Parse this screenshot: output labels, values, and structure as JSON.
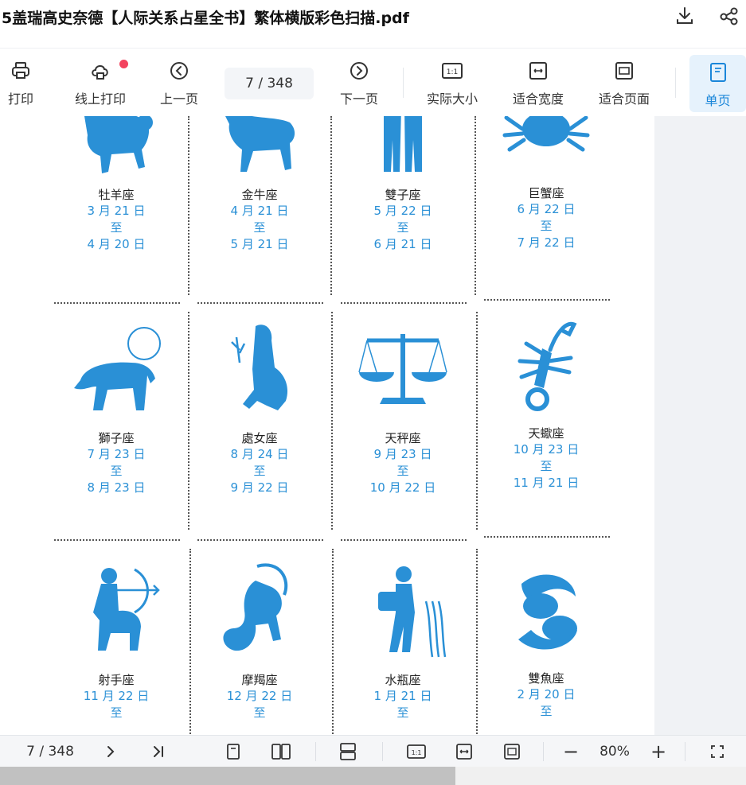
{
  "title": "5盖瑞高史奈德【人际关系占星全书】繁体横版彩色扫描.pdf",
  "top_icons": [
    "download-icon",
    "share-icon"
  ],
  "toolbar": {
    "print": "打印",
    "online_print": "线上打印",
    "prev_page": "上一页",
    "page_display": "7  / 348",
    "next_page": "下一页",
    "actual_size": "实际大小",
    "fit_width": "适合宽度",
    "fit_page": "适合页面",
    "single_page": "单页"
  },
  "signs": [
    {
      "name": "牡羊座",
      "from": "3 月 21 日",
      "to_word": "至",
      "to": "4 月 20 日",
      "icon": "aries-ram-icon"
    },
    {
      "name": "金牛座",
      "from": "4 月 21 日",
      "to_word": "至",
      "to": "5 月 21 日",
      "icon": "taurus-bull-icon"
    },
    {
      "name": "雙子座",
      "from": "5 月 22 日",
      "to_word": "至",
      "to": "6 月 21 日",
      "icon": "gemini-twins-icon"
    },
    {
      "name": "巨蟹座",
      "from": "6 月 22 日",
      "to_word": "至",
      "to": "7 月 22 日",
      "icon": "cancer-crab-icon"
    },
    {
      "name": "獅子座",
      "from": "7 月 23 日",
      "to_word": "至",
      "to": "8 月 23 日",
      "icon": "leo-lion-icon"
    },
    {
      "name": "處女座",
      "from": "8 月 24 日",
      "to_word": "至",
      "to": "9 月 22 日",
      "icon": "virgo-maiden-icon"
    },
    {
      "name": "天秤座",
      "from": "9 月 23 日",
      "to_word": "至",
      "to": "10 月 22 日",
      "icon": "libra-scales-icon"
    },
    {
      "name": "天蠍座",
      "from": "10 月 23 日",
      "to_word": "至",
      "to": "11 月 21 日",
      "icon": "scorpio-scorpion-icon"
    },
    {
      "name": "射手座",
      "from": "11 月 22 日",
      "to_word": "至",
      "to": "",
      "icon": "sagittarius-archer-icon"
    },
    {
      "name": "摩羯座",
      "from": "12 月 22 日",
      "to_word": "至",
      "to": "",
      "icon": "capricorn-goat-icon"
    },
    {
      "name": "水瓶座",
      "from": "1 月 21 日",
      "to_word": "至",
      "to": "",
      "icon": "aquarius-water-bearer-icon"
    },
    {
      "name": "雙魚座",
      "from": "2 月 20 日",
      "to_word": "至",
      "to": "",
      "icon": "pisces-fish-icon"
    }
  ],
  "bottom": {
    "page_display": "7  / 348",
    "zoom": "80%",
    "minus": "−",
    "plus": "+"
  },
  "scroll_progress": 0.61,
  "colors": {
    "accent": "#1a86d9",
    "zodiac_blue": "#2a90d6",
    "badge": "#f3435f"
  }
}
